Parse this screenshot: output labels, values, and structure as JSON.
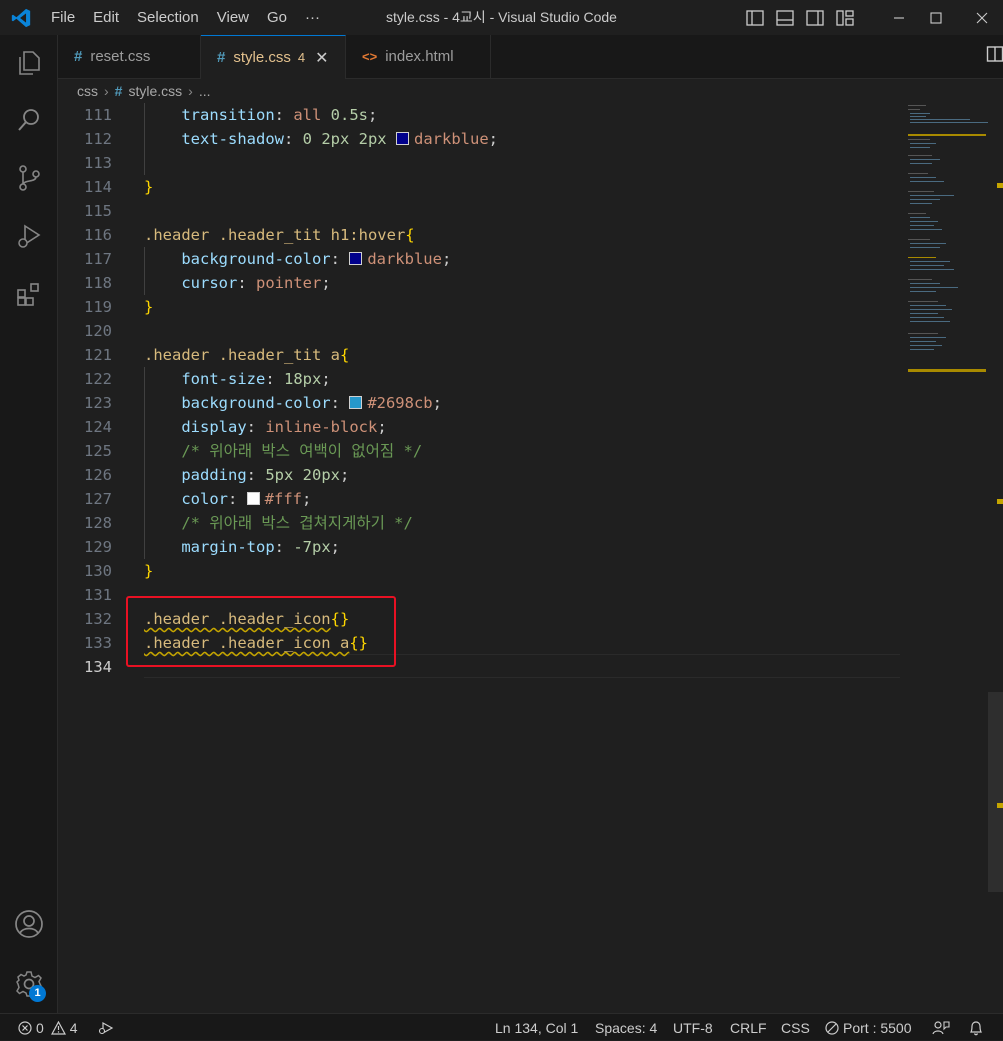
{
  "window": {
    "title": "style.css - 4교시 - Visual Studio Code",
    "menu": [
      "File",
      "Edit",
      "Selection",
      "View",
      "Go",
      "···"
    ]
  },
  "tabs": [
    {
      "label": "reset.css",
      "icon": "hash-icon",
      "active": false
    },
    {
      "label": "style.css",
      "icon": "hash-icon",
      "active": true,
      "problems": "4"
    },
    {
      "label": "index.html",
      "icon": "html-brackets-icon",
      "active": false
    }
  ],
  "breadcrumb": {
    "folder": "css",
    "file": "style.css",
    "more": "..."
  },
  "editor": {
    "current_line": "134",
    "lines": [
      {
        "n": "111"
      },
      {
        "n": "112"
      },
      {
        "n": "113"
      },
      {
        "n": "114"
      },
      {
        "n": "115"
      },
      {
        "n": "116"
      },
      {
        "n": "117"
      },
      {
        "n": "118"
      },
      {
        "n": "119"
      },
      {
        "n": "120"
      },
      {
        "n": "121"
      },
      {
        "n": "122"
      },
      {
        "n": "123"
      },
      {
        "n": "124"
      },
      {
        "n": "125"
      },
      {
        "n": "126"
      },
      {
        "n": "127"
      },
      {
        "n": "128"
      },
      {
        "n": "129"
      },
      {
        "n": "130"
      },
      {
        "n": "131"
      },
      {
        "n": "132"
      },
      {
        "n": "133"
      },
      {
        "n": "134"
      }
    ],
    "code": {
      "l111_prop": "transition",
      "l111_val": "all",
      "l111_num": "0.5s",
      "l112_prop": "text-shadow",
      "l112_nums": "0 2px 2px",
      "l112_val": "darkblue",
      "l112_color": "#00008b",
      "l116_sel": ".header .header_tit h1:hover",
      "l117_prop": "background-color",
      "l117_val": "darkblue",
      "l117_color": "#00008b",
      "l118_prop": "cursor",
      "l118_val": "pointer",
      "l121_sel": ".header .header_tit a",
      "l122_prop": "font-size",
      "l122_num": "18px",
      "l123_prop": "background-color",
      "l123_val": "#2698cb",
      "l123_color": "#2698cb",
      "l124_prop": "display",
      "l124_val": "inline-block",
      "l125_comment": "/* 위아래 박스 여백이 없어짐 */",
      "l126_prop": "padding",
      "l126_num": "5px 20px",
      "l127_prop": "color",
      "l127_val": "#fff",
      "l127_color": "#ffffff",
      "l128_comment": "/* 위아래 박스 겹쳐지게하기 */",
      "l129_prop": "margin-top",
      "l129_num": "-7px",
      "l132_sel": ".header .header_icon",
      "l133_sel": ".header .header_icon a"
    }
  },
  "status": {
    "errors": "0",
    "warnings": "4",
    "position": "Ln 134, Col 1",
    "spaces": "Spaces: 4",
    "encoding": "UTF-8",
    "eol": "CRLF",
    "language": "CSS",
    "port": "Port : 5500"
  },
  "activity": {
    "settings_badge": "1"
  },
  "colors": {
    "accent": "#0078d4",
    "highlight_box": "#e81123",
    "warning": "#c5a500"
  }
}
